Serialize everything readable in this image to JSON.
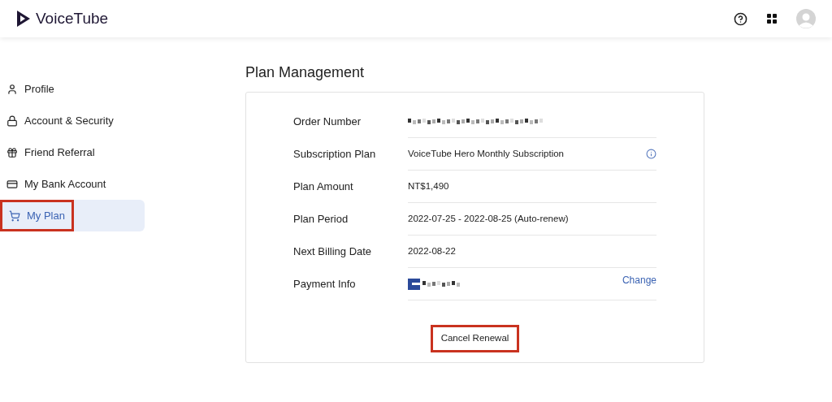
{
  "header": {
    "logo": "VoiceTube"
  },
  "sidebar": {
    "items": [
      {
        "label": "Profile",
        "selected": false,
        "highlighted": false
      },
      {
        "label": "Account & Security",
        "selected": false,
        "highlighted": false
      },
      {
        "label": "Friend Referral",
        "selected": false,
        "highlighted": false
      },
      {
        "label": "My Bank Account",
        "selected": false,
        "highlighted": false
      },
      {
        "label": "My Plan",
        "selected": true,
        "highlighted": true
      }
    ]
  },
  "main": {
    "title": "Plan Management",
    "rows": [
      {
        "label": "Order Number",
        "kind": "redacted"
      },
      {
        "label": "Subscription Plan",
        "kind": "info",
        "value": "VoiceTube Hero Monthly Subscription"
      },
      {
        "label": "Plan Amount",
        "kind": "text",
        "value": "NT$1,490"
      },
      {
        "label": "Plan Period",
        "kind": "text",
        "value": "2022-07-25 - 2022-08-25  (Auto-renew)"
      },
      {
        "label": "Next Billing Date",
        "kind": "text",
        "value": "2022-08-22"
      },
      {
        "label": "Payment Info",
        "kind": "payment",
        "action": "Change"
      }
    ],
    "button": {
      "label": "Cancel Renewal",
      "highlighted": true
    }
  }
}
